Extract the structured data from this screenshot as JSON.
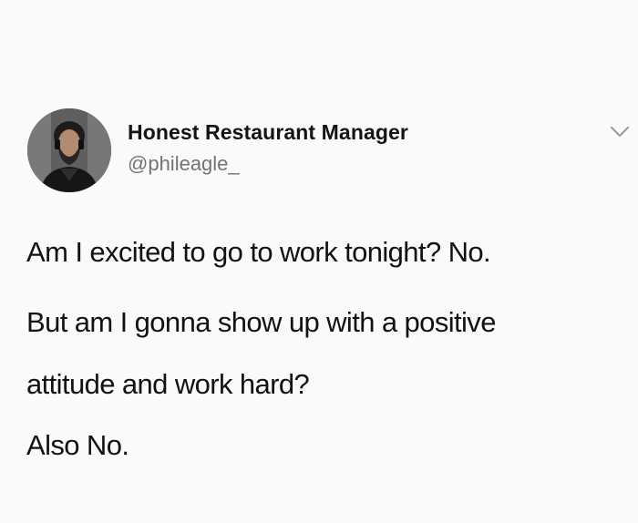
{
  "tweet": {
    "author": {
      "display_name": "Honest Restaurant Manager",
      "handle": "@phileagle_",
      "avatar_icon": "profile-photo"
    },
    "menu_icon": "chevron-down-icon",
    "text_lines": [
      "Am I excited to go to work tonight? No.",
      "But am I gonna show up with a positive",
      "attitude and work hard?",
      "Also No."
    ]
  },
  "colors": {
    "background": "#fafafa",
    "text": "#121212",
    "handle": "#6f7479",
    "chevron": "#9aa0a6"
  }
}
